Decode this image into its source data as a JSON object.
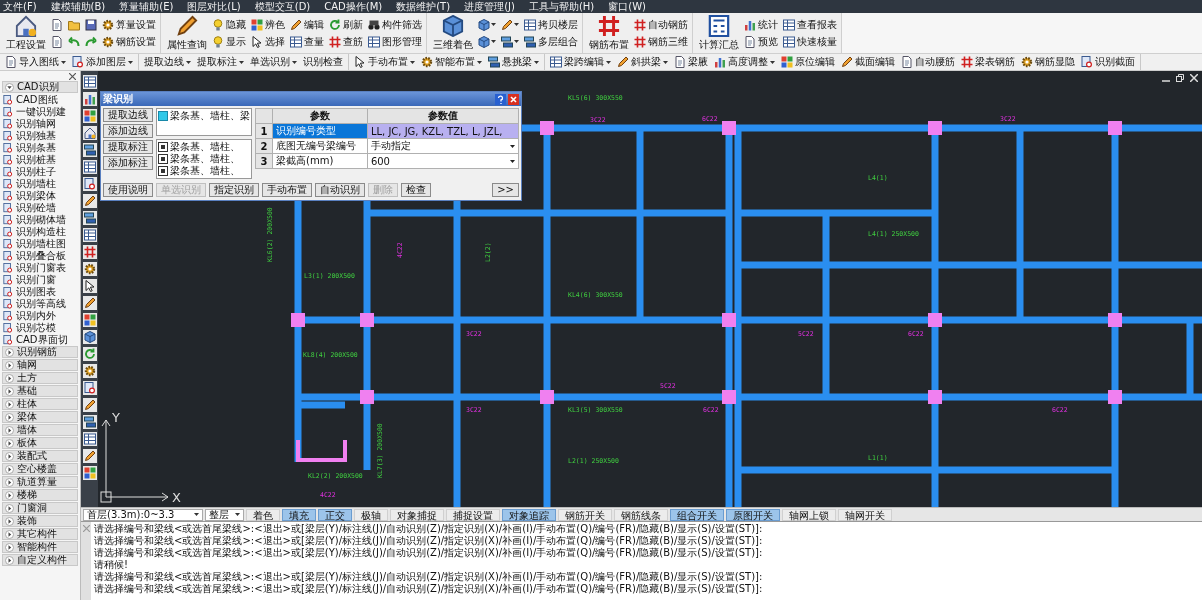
{
  "menu": [
    "文件(F)",
    "建模辅助(B)",
    "算量辅助(E)",
    "图层对比(L)",
    "模型交互(D)",
    "CAD操作(M)",
    "数据维护(T)",
    "进度管理(J)",
    "工具与帮助(H)",
    "窗口(W)"
  ],
  "ribbon": [
    {
      "items": [
        {
          "kind": "large",
          "label": "工程设置"
        },
        {
          "kind": "icon"
        },
        {
          "kind": "icon"
        },
        {
          "kind": "icon"
        },
        {
          "kind": "icon"
        },
        {
          "kind": "icon"
        },
        {
          "kind": "icon"
        },
        {
          "kind": "small",
          "label": "算量设置"
        },
        {
          "kind": "small",
          "label": "钢筋设置"
        }
      ]
    },
    {
      "items": [
        {
          "kind": "large",
          "label": "属性查询"
        },
        {
          "kind": "small",
          "label": "隐藏"
        },
        {
          "kind": "small",
          "label": "显示"
        },
        {
          "kind": "small",
          "label": "辨色"
        },
        {
          "kind": "small",
          "label": "选择"
        },
        {
          "kind": "small",
          "label": "编辑"
        },
        {
          "kind": "small",
          "label": "查量"
        },
        {
          "kind": "small",
          "label": "刷新"
        },
        {
          "kind": "small",
          "label": "查筋"
        },
        {
          "kind": "small",
          "label": "构件筛选"
        },
        {
          "kind": "small",
          "label": "图形管理"
        }
      ]
    },
    {
      "items": [
        {
          "kind": "large",
          "label": "三维着色"
        },
        {
          "kind": "iconmenu"
        },
        {
          "kind": "iconmenu"
        },
        {
          "kind": "iconmenu"
        },
        {
          "kind": "iconmenu"
        },
        {
          "kind": "small",
          "label": "拷贝楼层"
        },
        {
          "kind": "small",
          "label": "多层组合"
        }
      ]
    },
    {
      "items": [
        {
          "kind": "large",
          "label": "钢筋布置"
        },
        {
          "kind": "small",
          "label": "自动钢筋"
        },
        {
          "kind": "small",
          "label": "钢筋三维"
        }
      ]
    },
    {
      "items": [
        {
          "kind": "large",
          "label": "计算汇总"
        },
        {
          "kind": "small",
          "label": "统计"
        },
        {
          "kind": "small",
          "label": "预览"
        },
        {
          "kind": "small",
          "label": "查看报表"
        },
        {
          "kind": "small",
          "label": "快速核量"
        }
      ]
    }
  ],
  "toolbar": [
    {
      "items": [
        {
          "label": "导入图纸",
          "dropdown": true
        },
        {
          "label": "添加图层",
          "dropdown": true
        }
      ]
    },
    {
      "items": [
        {
          "label": "提取边线",
          "dropdown": true
        },
        {
          "label": "提取标注",
          "dropdown": true
        },
        {
          "label": "单选识别",
          "dropdown": true
        },
        {
          "label": "识别检查",
          "dropdown": false
        }
      ]
    },
    {
      "items": [
        {
          "label": "手动布置",
          "dropdown": true
        },
        {
          "label": "智能布置",
          "dropdown": true
        },
        {
          "label": "悬挑梁",
          "dropdown": true
        }
      ]
    },
    {
      "items": [
        {
          "label": "梁跨编辑",
          "dropdown": true
        },
        {
          "label": "斜拱梁",
          "dropdown": true
        },
        {
          "label": "梁腋",
          "dropdown": false
        },
        {
          "label": "高度调整",
          "dropdown": true
        },
        {
          "label": "原位编辑",
          "dropdown": false
        },
        {
          "label": "截面编辑",
          "dropdown": false
        },
        {
          "label": "自动腰筋",
          "dropdown": false
        },
        {
          "label": "梁表钢筋",
          "dropdown": false
        },
        {
          "label": "钢筋显隐",
          "dropdown": false
        },
        {
          "label": "识别截面",
          "dropdown": false
        }
      ]
    }
  ],
  "sidebar": {
    "sections": [
      {
        "label": "CAD识别",
        "expanded": true,
        "children": [
          {
            "label": "CAD图纸"
          },
          {
            "label": "一键识别建"
          },
          {
            "label": "识别轴网"
          },
          {
            "label": "识别独基"
          },
          {
            "label": "识别条基"
          },
          {
            "label": "识别桩基"
          },
          {
            "label": "识别柱子"
          },
          {
            "label": "识别墙柱"
          },
          {
            "label": "识别梁体"
          },
          {
            "label": "识别砼墙"
          },
          {
            "label": "识别砌体墙"
          },
          {
            "label": "识别构造柱"
          },
          {
            "label": "识别墙柱图"
          },
          {
            "label": "识别叠合板"
          },
          {
            "label": "识别门窗表"
          },
          {
            "label": "识别门窗"
          },
          {
            "label": "识别图表"
          },
          {
            "label": "识别等高线"
          },
          {
            "label": "识别内外"
          },
          {
            "label": "识别芯模"
          },
          {
            "label": "CAD界面切"
          }
        ]
      },
      {
        "label": "识别钢筋",
        "expanded": false
      },
      {
        "label": "轴网",
        "expanded": false
      },
      {
        "label": "土方",
        "expanded": false
      },
      {
        "label": "基础",
        "expanded": false
      },
      {
        "label": "柱体",
        "expanded": false
      },
      {
        "label": "梁体",
        "expanded": false
      },
      {
        "label": "墙体",
        "expanded": false
      },
      {
        "label": "板体",
        "expanded": false
      },
      {
        "label": "装配式",
        "expanded": false
      },
      {
        "label": "空心楼盖",
        "expanded": false
      },
      {
        "label": "轨道算量",
        "expanded": false
      },
      {
        "label": "楼梯",
        "expanded": false
      },
      {
        "label": "门窗洞",
        "expanded": false
      },
      {
        "label": "装饰",
        "expanded": false
      },
      {
        "label": "其它构件",
        "expanded": false
      },
      {
        "label": "智能构件",
        "expanded": false
      },
      {
        "label": "自定义构件",
        "expanded": false
      }
    ]
  },
  "dialog": {
    "title": "梁识别",
    "side_buttons": [
      "提取边线",
      "添加边线",
      "提取标注",
      "添加标注"
    ],
    "layer_box": [
      {
        "label": "梁条基、墙柱、梁",
        "checked": true
      }
    ],
    "layer_list": [
      {
        "label": "梁条基、墙柱、",
        "checked": true
      },
      {
        "label": "梁条基、墙柱、",
        "checked": true
      },
      {
        "label": "梁条基、墙柱、",
        "checked": true
      }
    ],
    "table": {
      "columns": [
        "参数",
        "参数值"
      ],
      "rows": [
        {
          "index": "1",
          "param": "识别编号类型",
          "value": "LL, JC, JG, KZL, TZL, L, JZL,",
          "selected": true,
          "dropdown": false
        },
        {
          "index": "2",
          "param": "底图无编号梁编号",
          "value": "手动指定",
          "selected": false,
          "dropdown": true
        },
        {
          "index": "3",
          "param": "梁截高(mm)",
          "value": "600",
          "selected": false,
          "dropdown": true
        }
      ]
    },
    "buttons": [
      {
        "label": "使用说明",
        "disabled": false
      },
      {
        "label": "单选识别",
        "disabled": true
      },
      {
        "label": "指定识别",
        "disabled": false
      },
      {
        "label": "手动布置",
        "disabled": false
      },
      {
        "label": "自动识别",
        "disabled": false
      },
      {
        "label": "删除",
        "disabled": true
      },
      {
        "label": "检查",
        "disabled": false
      },
      {
        "label": ">>",
        "disabled": false
      }
    ]
  },
  "canvas": {
    "labels": [
      {
        "text": "KL5(6) 300X550",
        "kind": "beam"
      },
      {
        "text": "L4(1)",
        "kind": "beam"
      },
      {
        "text": "L4(1) 250X500",
        "kind": "beam"
      },
      {
        "text": "L2(2)",
        "kind": "beam"
      },
      {
        "text": "L3(1) 200X500",
        "kind": "beam"
      },
      {
        "text": "KL4(6) 300X550",
        "kind": "beam"
      },
      {
        "text": "KL6(2) 200X500",
        "kind": "beam"
      },
      {
        "text": "KL8(4) 200X500",
        "kind": "beam"
      },
      {
        "text": "KL3(5) 300X550",
        "kind": "beam"
      },
      {
        "text": "L2(1) 250X500",
        "kind": "beam"
      },
      {
        "text": "KL2(2) 200X500",
        "kind": "beam"
      },
      {
        "text": "KL7(3) 200X500",
        "kind": "beam"
      },
      {
        "text": "L1(1)",
        "kind": "beam"
      },
      {
        "text": "3C22",
        "kind": "rebar"
      },
      {
        "text": "6C22",
        "kind": "rebar"
      },
      {
        "text": "3C22",
        "kind": "rebar"
      },
      {
        "text": "5C22",
        "kind": "rebar"
      },
      {
        "text": "6C22",
        "kind": "rebar"
      },
      {
        "text": "4C22",
        "kind": "rebar"
      },
      {
        "text": "3C22",
        "kind": "rebar"
      },
      {
        "text": "5C22",
        "kind": "rebar"
      },
      {
        "text": "6C22",
        "kind": "rebar"
      },
      {
        "text": "4C22",
        "kind": "rebar"
      },
      {
        "text": "3C22",
        "kind": "rebar"
      },
      {
        "text": "6C22",
        "kind": "rebar"
      }
    ],
    "axis": {
      "y": "Y",
      "x": "X"
    }
  },
  "status_bar": {
    "floor": "首层(3.3m):0~3.3",
    "scope": "整层",
    "toggles": [
      {
        "label": "着色",
        "on": false
      },
      {
        "label": "填充",
        "on": true
      },
      {
        "label": "正交",
        "on": true
      },
      {
        "label": "极轴",
        "on": false
      },
      {
        "label": "对象捕捉",
        "on": false
      },
      {
        "label": "捕捉设置",
        "on": false
      },
      {
        "label": "对象追踪",
        "on": true
      },
      {
        "label": "钢筋开关",
        "on": false
      },
      {
        "label": "钢筋线条",
        "on": false
      },
      {
        "label": "组合开关",
        "on": true
      },
      {
        "label": "原图开关",
        "on": true
      },
      {
        "label": "轴网上锁",
        "on": false
      },
      {
        "label": "轴网开关",
        "on": false
      }
    ]
  },
  "command_lines": [
    "请选择编号和梁线<或选首尾梁线>:<退出>或[梁层(Y)/标注线(J)/自动识别(Z)/指定识别(X)/补画(I)/手动布置(Q)/编号(FR)/隐藏(B)/显示(S)/设置(ST)]:",
    "请选择编号和梁线<或选首尾梁线>:<退出>或[梁层(Y)/标注线(J)/自动识别(Z)/指定识别(X)/补画(I)/手动布置(Q)/编号(FR)/隐藏(B)/显示(S)/设置(ST)]:",
    "请选择编号和梁线<或选首尾梁线>:<退出>或[梁层(Y)/标注线(J)/自动识别(Z)/指定识别(X)/补画(I)/手动布置(Q)/编号(FR)/隐藏(B)/显示(S)/设置(ST)]:",
    "请稍候!",
    "请选择编号和梁线<或选首尾梁线>:<退出>或[梁层(Y)/标注线(J)/自动识别(Z)/指定识别(X)/补画(I)/手动布置(Q)/编号(FR)/隐藏(B)/显示(S)/设置(ST)]:",
    "请选择编号和梁线<或选首尾梁线>:<退出>或[梁层(Y)/标注线(J)/自动识别(Z)/指定识别(X)/补画(I)/手动布置(Q)/编号(FR)/隐藏(B)/显示(S)/设置(ST)]:"
  ]
}
